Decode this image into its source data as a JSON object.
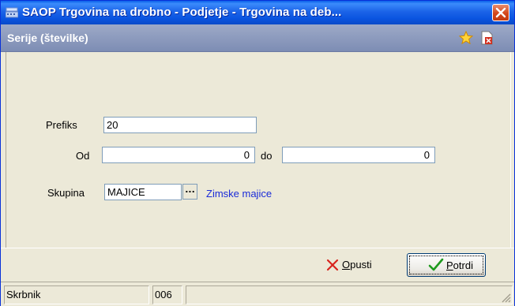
{
  "window": {
    "title": "SAOP Trgovina na drobno - Podjetje - Trgovina na deb..."
  },
  "header": {
    "title": "Serije (številke)"
  },
  "form": {
    "prefix_label": "Prefiks",
    "prefix_value": "20",
    "from_label": "Od",
    "from_value": "0",
    "to_label": "do",
    "to_value": "0",
    "group_label": "Skupina",
    "group_value": "MAJICE",
    "group_button": "...",
    "group_link": "Zimske majice"
  },
  "buttons": {
    "cancel_hotkey": "O",
    "cancel_rest": "pusti",
    "ok_hotkey": "P",
    "ok_rest": "otrdi"
  },
  "status": {
    "user": "Skrbnik",
    "code": "006",
    "extra": ""
  },
  "colors": {
    "titlebar": "#0A54E0",
    "header": "#7D8DB4",
    "link": "#1A2BD8",
    "close": "#D4471A"
  },
  "icons": {
    "app": "cash-register-icon",
    "close": "close-icon",
    "favorite": "star-icon",
    "export": "pdf-close-icon",
    "cancel": "red-x-icon",
    "ok": "green-check-icon"
  }
}
